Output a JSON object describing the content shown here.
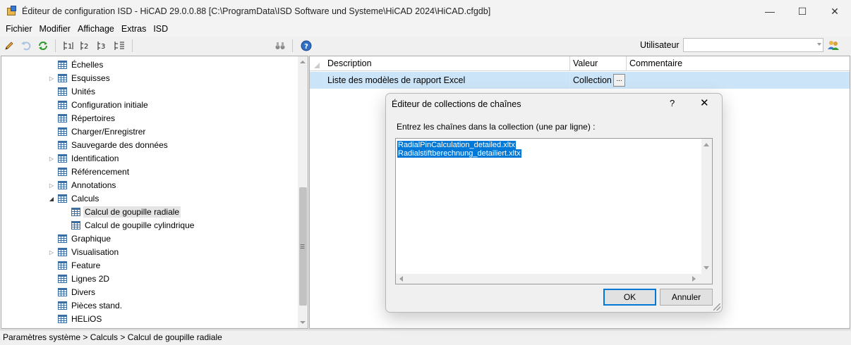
{
  "window": {
    "title": "Éditeur de configuration ISD  -  HiCAD 29.0.0.88 [C:\\ProgramData\\ISD Software und Systeme\\HiCAD 2024\\HiCAD.cfgdb]",
    "minimize_icon": "minimize-icon",
    "maximize_icon": "maximize-icon",
    "close_icon": "close-icon",
    "minimize_glyph": "—",
    "maximize_glyph": "☐",
    "close_glyph": "✕"
  },
  "menu": [
    "Fichier",
    "Modifier",
    "Affichage",
    "Extras",
    "ISD"
  ],
  "toolbar": {
    "user_label": "Utilisateur",
    "user_value": "",
    "icons": [
      "pencil-icon",
      "undo-icon",
      "refresh-icon",
      "level-1-icon",
      "level-2-icon",
      "level-3-icon",
      "level-all-icon",
      "binoculars-icon",
      "help-icon",
      "users-icon"
    ]
  },
  "tree": {
    "items": [
      {
        "label": "Échelles",
        "expandable": false
      },
      {
        "label": "Esquisses",
        "expandable": true
      },
      {
        "label": "Unités",
        "expandable": false
      },
      {
        "label": "Configuration initiale",
        "expandable": false
      },
      {
        "label": "Répertoires",
        "expandable": false
      },
      {
        "label": "Charger/Enregistrer",
        "expandable": false
      },
      {
        "label": "Sauvegarde des données",
        "expandable": false
      },
      {
        "label": "Identification",
        "expandable": true
      },
      {
        "label": "Référencement",
        "expandable": false
      },
      {
        "label": "Annotations",
        "expandable": true
      },
      {
        "label": "Calculs",
        "expandable": true,
        "expanded": true
      },
      {
        "label": "Calcul de goupille radiale",
        "child": true,
        "selected": true
      },
      {
        "label": "Calcul de goupille cylindrique",
        "child": true
      },
      {
        "label": "Graphique",
        "expandable": false
      },
      {
        "label": "Visualisation",
        "expandable": true
      },
      {
        "label": "Feature",
        "expandable": false
      },
      {
        "label": "Lignes 2D",
        "expandable": false
      },
      {
        "label": "Divers",
        "expandable": false
      },
      {
        "label": "Pièces stand.",
        "expandable": false
      },
      {
        "label": "HELiOS",
        "expandable": false
      }
    ]
  },
  "grid": {
    "headers": [
      "Description",
      "Valeur",
      "Commentaire"
    ],
    "rows": [
      {
        "description": "Liste des modèles de rapport Excel",
        "value": "Collection",
        "comment": "",
        "button": "..."
      }
    ]
  },
  "status": {
    "path": "Paramètres système > Calculs > Calcul de goupille radiale"
  },
  "dialog": {
    "title": "Éditeur de collections de chaînes",
    "help_glyph": "?",
    "close_glyph": "✕",
    "prompt": "Entrez les chaînes dans la collection (une par ligne) :",
    "lines": [
      "RadialPinCalculation_detailed.xltx",
      "Radialstiftberechnung_detailiert.xltx"
    ],
    "ok_label": "OK",
    "cancel_label": "Annuler"
  },
  "colors": {
    "selection_blue": "#0078d7",
    "row_highlight": "#cce4f7",
    "tree_icon_blue": "#3a6ea5"
  }
}
